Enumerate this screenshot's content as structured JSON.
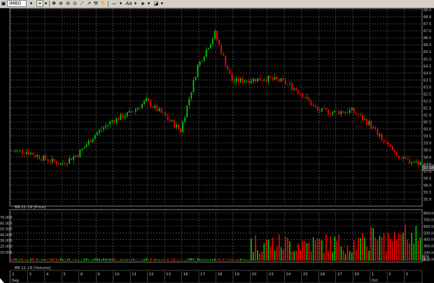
{
  "toolbar": {
    "symbol": "IM60",
    "items": [
      {
        "name": "chart-menu-icon",
        "glyph": "▣"
      },
      {
        "name": "dropdown-icon",
        "glyph": "▾"
      },
      {
        "name": "crosshair-icon",
        "glyph": "+"
      },
      {
        "name": "dropdown-icon",
        "glyph": "▾"
      },
      {
        "name": "move-icon",
        "glyph": "✥"
      },
      {
        "name": "zoom-in-icon",
        "glyph": "⊕"
      },
      {
        "name": "zoom-out-icon",
        "glyph": "⊖"
      },
      {
        "name": "zoom-reset-icon",
        "glyph": "⊙"
      },
      {
        "name": "draw-line-icon",
        "glyph": "⟋"
      },
      {
        "name": "ray-icon",
        "glyph": "↗"
      },
      {
        "name": "tool-icon",
        "glyph": "⚒"
      },
      {
        "name": "hand-icon",
        "glyph": "✋"
      },
      {
        "name": "line-style-icon",
        "glyph": "—"
      },
      {
        "name": "dropdown-icon",
        "glyph": "▾"
      },
      {
        "name": "text-icon",
        "glyph": "Aa"
      },
      {
        "name": "dropdown-icon",
        "glyph": "▾"
      },
      {
        "name": "fill-icon",
        "glyph": "◈"
      },
      {
        "name": "dropdown-icon",
        "glyph": "▾"
      },
      {
        "name": "settings-icon",
        "glyph": "◪"
      },
      {
        "name": "dropdown-icon",
        "glyph": "▾"
      }
    ]
  },
  "price_pane": {
    "legend": "BR-11.19 [Price]",
    "current_price_label": "57.58",
    "y_ticks": [
      "68.5",
      "68.0",
      "67.5",
      "67.0",
      "66.5",
      "66.0",
      "65.5",
      "65.0",
      "64.5",
      "64.0",
      "63.5",
      "63.0",
      "62.5",
      "62.0",
      "61.5",
      "61.0",
      "60.5",
      "60.0",
      "59.5",
      "59.0",
      "58.5",
      "58.0",
      "57.5",
      "57.0",
      "56.5",
      "56.0",
      "55.5",
      "55.0"
    ],
    "top_tick": "68.5"
  },
  "volume_pane": {
    "legend": "BR-11.19 [Volume]",
    "right_ticks": [
      "800.00",
      "700.00",
      "600.00",
      "500.00",
      "400.00",
      "300.00",
      "200.00",
      "100.00"
    ],
    "left_ticks": [
      "70.000",
      "60.000",
      "50.000",
      "40.000",
      "30.000",
      "20.000",
      "10.000"
    ],
    "current_label": "1"
  },
  "time_axis": {
    "days": [
      "2",
      "3",
      "4",
      "5",
      "6",
      "9",
      "10",
      "11",
      "12",
      "13",
      "16",
      "17",
      "18",
      "19",
      "20",
      "23",
      "24",
      "25",
      "26",
      "27",
      "30",
      "1",
      "2",
      "3"
    ],
    "month_labels": [
      {
        "text": "Sep",
        "at": "2"
      },
      {
        "text": "Oct",
        "at": "1"
      }
    ]
  },
  "colors": {
    "up": "#00c800",
    "down": "#ff0000",
    "grid": "#808080",
    "text": "#c8c8c8",
    "background": "#000000"
  },
  "chart_data": {
    "type": "candlestick",
    "symbol": "BR-11.19",
    "price_range": [
      55.0,
      68.5
    ],
    "grid": true,
    "close_path": [
      {
        "day": "2",
        "price": 58.4
      },
      {
        "day": "3",
        "price": 57.9
      },
      {
        "day": "4",
        "price": 57.5
      },
      {
        "day": "5",
        "price": 58.2
      },
      {
        "day": "6",
        "price": 59.6
      },
      {
        "day": "9",
        "price": 60.6
      },
      {
        "day": "10",
        "price": 61.1
      },
      {
        "day": "11",
        "price": 62.0
      },
      {
        "day": "12",
        "price": 61.0
      },
      {
        "day": "13",
        "price": 59.9
      },
      {
        "day": "16",
        "price": 64.5
      },
      {
        "day": "17",
        "price": 66.8
      },
      {
        "day": "18",
        "price": 63.4
      },
      {
        "day": "19",
        "price": 63.5
      },
      {
        "day": "20",
        "price": 63.6
      },
      {
        "day": "23",
        "price": 63.4
      },
      {
        "day": "24",
        "price": 62.6
      },
      {
        "day": "25",
        "price": 61.3
      },
      {
        "day": "26",
        "price": 61.2
      },
      {
        "day": "27",
        "price": 61.3
      },
      {
        "day": "30",
        "price": 60.4
      },
      {
        "day": "1",
        "price": 58.9
      },
      {
        "day": "2",
        "price": 57.8
      },
      {
        "day": "3",
        "price": 57.6
      }
    ]
  }
}
